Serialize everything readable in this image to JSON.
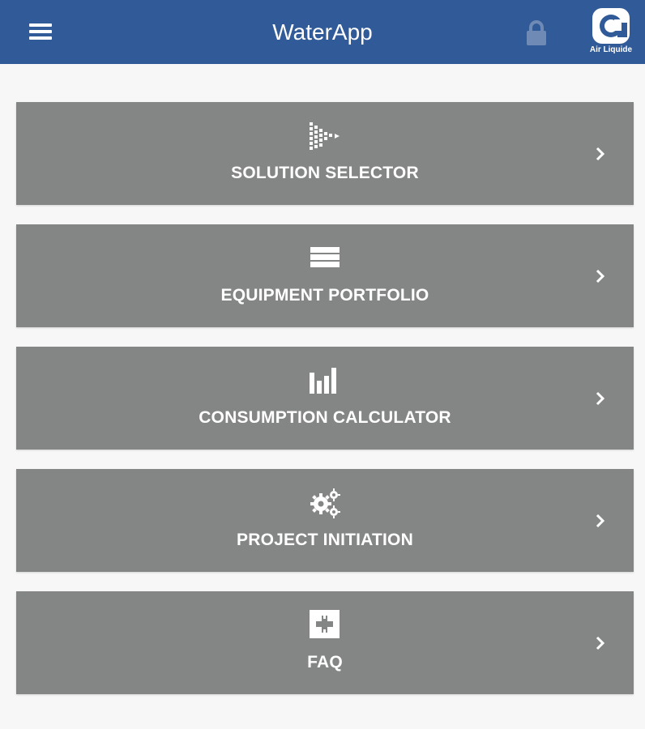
{
  "header": {
    "title": "WaterApp",
    "menu_icon": "hamburger-menu-icon",
    "lock_icon": "lock-icon",
    "logo_text": "Air Liquide",
    "background_color": "#315b98"
  },
  "menu": {
    "items": [
      {
        "label": "SOLUTION SELECTOR",
        "icon": "funnel-triangle-icon"
      },
      {
        "label": "EQUIPMENT PORTFOLIO",
        "icon": "stacked-layers-icon"
      },
      {
        "label": "CONSUMPTION CALCULATOR",
        "icon": "bar-chart-icon"
      },
      {
        "label": "PROJECT INITIATION",
        "icon": "gears-icon"
      },
      {
        "label": "FAQ",
        "icon": "first-aid-plus-icon"
      }
    ],
    "chevron_icon": "chevron-right-icon",
    "card_color": "#848685"
  }
}
